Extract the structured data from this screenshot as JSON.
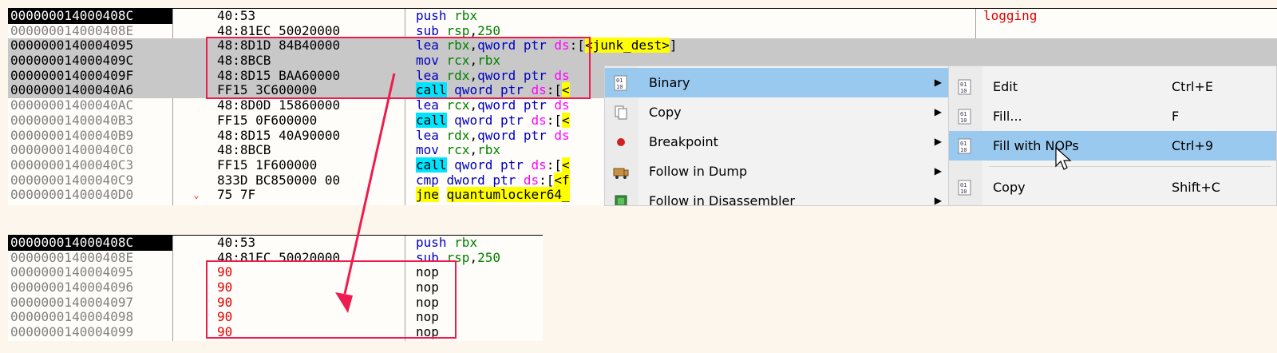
{
  "top": {
    "rows": [
      {
        "addr": "000000014000408C",
        "jmp": "",
        "bytes": "40:53",
        "instr": [
          [
            "kw-blue",
            "push "
          ],
          [
            "kw-green",
            "rbx"
          ]
        ],
        "comment": "logging",
        "cur": true,
        "sel": false
      },
      {
        "addr": "000000014000408E",
        "jmp": "",
        "bytes": "48:81EC 50020000",
        "instr": [
          [
            "kw-blue",
            "sub "
          ],
          [
            "kw-green",
            "rsp"
          ],
          [
            "kw-black",
            ","
          ],
          [
            "kw-green",
            "250"
          ]
        ],
        "comment": "",
        "cur": false,
        "sel": false
      },
      {
        "addr": "0000000140004095",
        "jmp": "",
        "bytes": "48:8D1D 84B40000",
        "instr": [
          [
            "kw-blue",
            "lea "
          ],
          [
            "kw-green",
            "rbx"
          ],
          [
            "kw-black",
            ","
          ],
          [
            "kw-blue",
            "qword ptr "
          ],
          [
            "kw-mag",
            "ds"
          ],
          [
            "kw-black",
            ":["
          ],
          [
            "hl-yellow",
            "<junk_dest>"
          ],
          [
            "kw-black",
            "]"
          ]
        ],
        "comment": "",
        "cur": false,
        "sel": true
      },
      {
        "addr": "000000014000409C",
        "jmp": "",
        "bytes": "48:8BCB",
        "instr": [
          [
            "kw-blue",
            "mov "
          ],
          [
            "kw-green",
            "rcx"
          ],
          [
            "kw-black",
            ","
          ],
          [
            "kw-green",
            "rbx"
          ]
        ],
        "comment": "",
        "cur": false,
        "sel": true
      },
      {
        "addr": "000000014000409F",
        "jmp": "",
        "bytes": "48:8D15 BAA60000",
        "instr": [
          [
            "kw-blue",
            "lea "
          ],
          [
            "kw-green",
            "rdx"
          ],
          [
            "kw-black",
            ","
          ],
          [
            "kw-blue",
            "qword ptr "
          ],
          [
            "kw-mag",
            "ds"
          ]
        ],
        "comment": "",
        "cur": false,
        "sel": true
      },
      {
        "addr": "00000001400040A6",
        "jmp": "",
        "bytes": "FF15 3C600000",
        "instr": [
          [
            "hl-call",
            "call"
          ],
          [
            "kw-black",
            " "
          ],
          [
            "kw-blue",
            "qword ptr "
          ],
          [
            "kw-mag",
            "ds"
          ],
          [
            "kw-black",
            ":["
          ],
          [
            "hl-yellow",
            "<"
          ]
        ],
        "comment": "",
        "cur": false,
        "sel": true
      },
      {
        "addr": "00000001400040AC",
        "jmp": "",
        "bytes": "48:8D0D 15860000",
        "instr": [
          [
            "kw-blue",
            "lea "
          ],
          [
            "kw-green",
            "rcx"
          ],
          [
            "kw-black",
            ","
          ],
          [
            "kw-blue",
            "qword ptr "
          ],
          [
            "kw-mag",
            "ds"
          ]
        ],
        "comment": "",
        "cur": false,
        "sel": false
      },
      {
        "addr": "00000001400040B3",
        "jmp": "",
        "bytes": "FF15 0F600000",
        "instr": [
          [
            "hl-call",
            "call"
          ],
          [
            "kw-black",
            " "
          ],
          [
            "kw-blue",
            "qword ptr "
          ],
          [
            "kw-mag",
            "ds"
          ],
          [
            "kw-black",
            ":["
          ],
          [
            "hl-yellow",
            "<"
          ]
        ],
        "comment": "",
        "cur": false,
        "sel": false
      },
      {
        "addr": "00000001400040B9",
        "jmp": "",
        "bytes": "48:8D15 40A90000",
        "instr": [
          [
            "kw-blue",
            "lea "
          ],
          [
            "kw-green",
            "rdx"
          ],
          [
            "kw-black",
            ","
          ],
          [
            "kw-blue",
            "qword ptr "
          ],
          [
            "kw-mag",
            "ds"
          ]
        ],
        "comment": "",
        "cur": false,
        "sel": false
      },
      {
        "addr": "00000001400040C0",
        "jmp": "",
        "bytes": "48:8BCB",
        "instr": [
          [
            "kw-blue",
            "mov "
          ],
          [
            "kw-green",
            "rcx"
          ],
          [
            "kw-black",
            ","
          ],
          [
            "kw-green",
            "rbx"
          ]
        ],
        "comment": "",
        "cur": false,
        "sel": false
      },
      {
        "addr": "00000001400040C3",
        "jmp": "",
        "bytes": "FF15 1F600000",
        "instr": [
          [
            "hl-call",
            "call"
          ],
          [
            "kw-black",
            " "
          ],
          [
            "kw-blue",
            "qword ptr "
          ],
          [
            "kw-mag",
            "ds"
          ],
          [
            "kw-black",
            ":["
          ],
          [
            "hl-yellow",
            "<"
          ]
        ],
        "comment": "",
        "cur": false,
        "sel": false
      },
      {
        "addr": "00000001400040C9",
        "jmp": "",
        "bytes": "833D BC850000 00",
        "instr": [
          [
            "kw-blue",
            "cmp "
          ],
          [
            "kw-blue",
            "dword ptr "
          ],
          [
            "kw-mag",
            "ds"
          ],
          [
            "kw-black",
            ":["
          ],
          [
            "hl-yellow",
            "<f"
          ]
        ],
        "comment": "",
        "cur": false,
        "sel": false
      },
      {
        "addr": "00000001400040D0",
        "jmp": "⌄",
        "bytes": "75 7F",
        "instr": [
          [
            "hl-yellow",
            "jne"
          ],
          [
            "kw-black",
            " "
          ],
          [
            "hl-yellow",
            "quantumlocker64_"
          ]
        ],
        "comment": "",
        "cur": false,
        "sel": false
      }
    ]
  },
  "bottom": {
    "rows": [
      {
        "addr": "000000014000408C",
        "bytes": "40:53",
        "nop": false,
        "instr": [
          [
            "kw-blue",
            "push "
          ],
          [
            "kw-green",
            "rbx"
          ]
        ],
        "cur": true
      },
      {
        "addr": "000000014000408E",
        "bytes": "48:81EC 50020000",
        "nop": false,
        "instr": [
          [
            "kw-blue",
            "sub "
          ],
          [
            "kw-green",
            "rsp"
          ],
          [
            "kw-black",
            ","
          ],
          [
            "kw-green",
            "250"
          ]
        ],
        "cur": false
      },
      {
        "addr": "0000000140004095",
        "bytes": "90",
        "nop": true,
        "instr": [
          [
            "nopi",
            "nop"
          ]
        ],
        "cur": false
      },
      {
        "addr": "0000000140004096",
        "bytes": "90",
        "nop": true,
        "instr": [
          [
            "nopi",
            "nop"
          ]
        ],
        "cur": false
      },
      {
        "addr": "0000000140004097",
        "bytes": "90",
        "nop": true,
        "instr": [
          [
            "nopi",
            "nop"
          ]
        ],
        "cur": false
      },
      {
        "addr": "0000000140004098",
        "bytes": "90",
        "nop": true,
        "instr": [
          [
            "nopi",
            "nop"
          ]
        ],
        "cur": false
      },
      {
        "addr": "0000000140004099",
        "bytes": "90",
        "nop": true,
        "instr": [
          [
            "nopi",
            "nop"
          ]
        ],
        "cur": false
      }
    ]
  },
  "context_menu": {
    "items": [
      {
        "label": "Binary",
        "icon": "binary-icon",
        "hot": true
      },
      {
        "label": "Copy",
        "icon": "copy-icon",
        "hot": false
      },
      {
        "label": "Breakpoint",
        "icon": "breakpoint-icon",
        "hot": false
      },
      {
        "label": "Follow in Dump",
        "icon": "dump-icon",
        "hot": false
      },
      {
        "label": "Follow in Disassembler",
        "icon": "disassembler-icon",
        "hot": false
      }
    ],
    "arrow": "▶"
  },
  "submenu": {
    "items": [
      {
        "label": "Edit",
        "shortcut": "Ctrl+E",
        "icon": "edit-binary-icon",
        "hot": false
      },
      {
        "label": "Fill...",
        "shortcut": "F",
        "icon": "fill-icon",
        "hot": false
      },
      {
        "label": "Fill with NOPs",
        "shortcut": "Ctrl+9",
        "icon": "nop-icon",
        "hot": true
      },
      {
        "label": "Copy",
        "shortcut": "Shift+C",
        "icon": "copy-binary-icon",
        "hot": false
      }
    ]
  },
  "colors": {
    "annotation": "#ee1c4e",
    "menu_highlight": "#99c9ef"
  }
}
